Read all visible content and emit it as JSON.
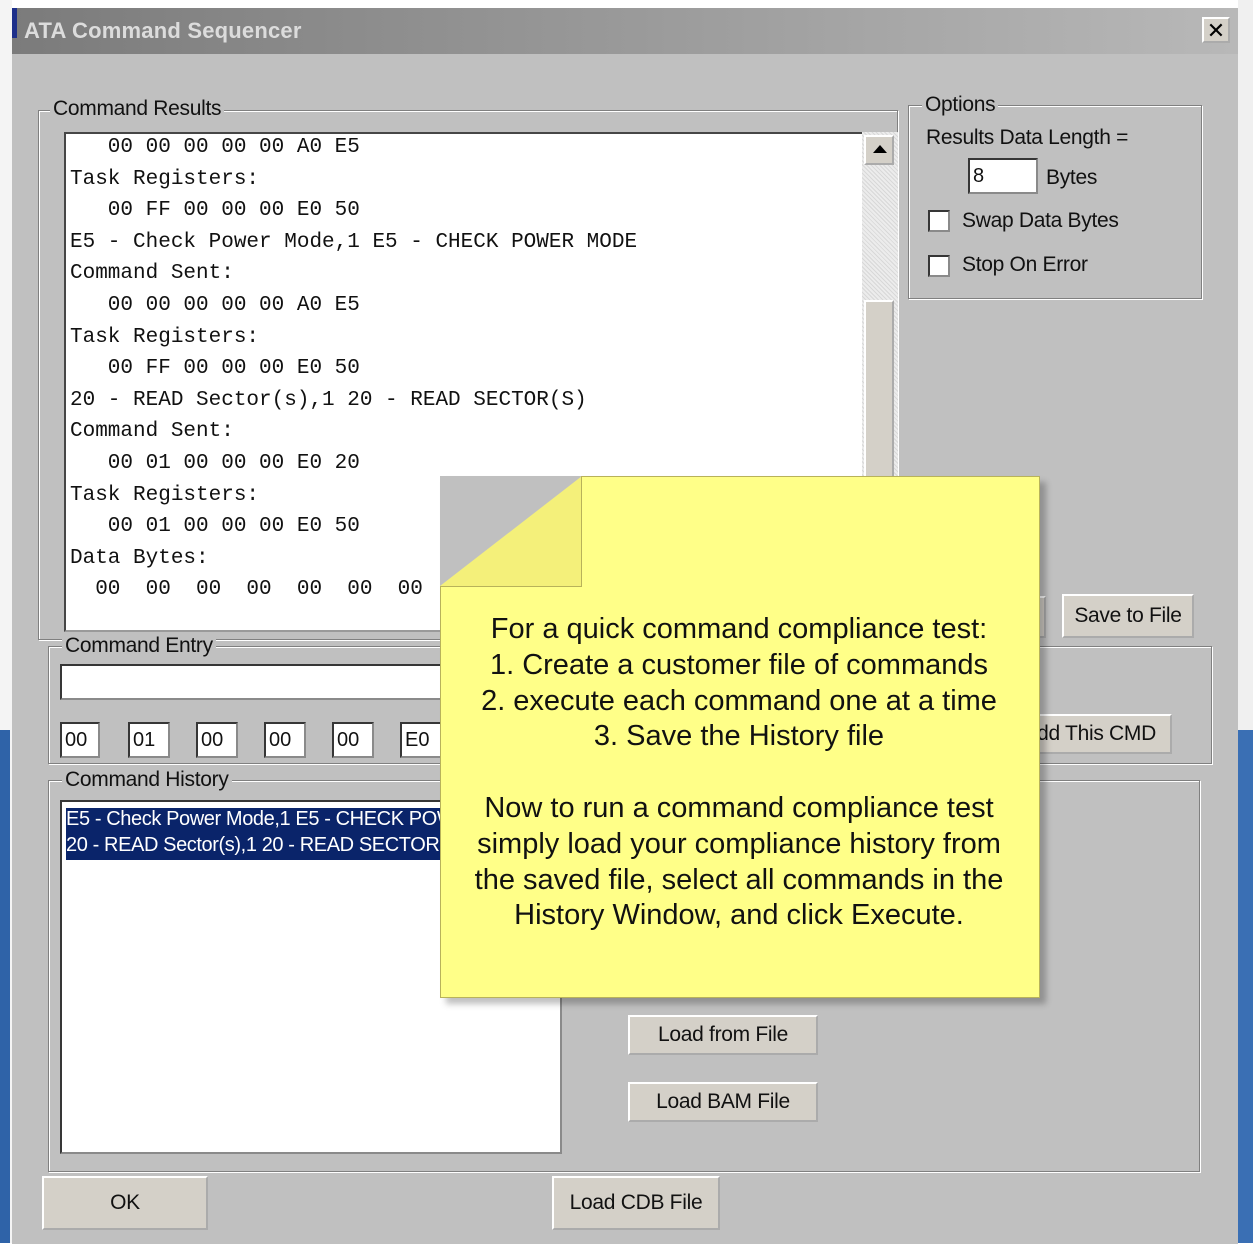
{
  "window": {
    "title": "ATA Command Sequencer",
    "close_glyph": "✕"
  },
  "results_group": {
    "label": "Command Results",
    "lines": [
      "   00 00 00 00 00 A0 E5",
      "Task Registers:",
      "   00 FF 00 00 00 E0 50",
      "E5 - Check Power Mode,1 E5 - CHECK POWER MODE",
      "Command Sent:",
      "   00 00 00 00 00 A0 E5",
      "Task Registers:",
      "   00 FF 00 00 00 E0 50",
      "20 - READ Sector(s),1 20 - READ SECTOR(S)",
      "Command Sent:",
      "   00 01 00 00 00 E0 20",
      "Task Registers:",
      "   00 01 00 00 00 E0 50",
      "Data Bytes:",
      "  00  00  00  00  00  00  00"
    ]
  },
  "options": {
    "label": "Options",
    "results_length_label": "Results Data Length =",
    "results_length_value": "8",
    "bytes_label": "Bytes",
    "swap_label": "Swap Data Bytes",
    "stop_label": "Stop On Error"
  },
  "buttons": {
    "save_to_file": "Save to File",
    "add_this_cmd": "dd This CMD",
    "load_from_file": "Load from File",
    "load_bam_file": "Load BAM File",
    "ok": "OK",
    "load_cdb_file": "Load CDB File"
  },
  "command_entry": {
    "label": "Command Entry",
    "text_value": "",
    "bytes": [
      "00",
      "01",
      "00",
      "00",
      "00",
      "E0"
    ]
  },
  "command_history": {
    "label": "Command History",
    "items": [
      "E5 - Check Power Mode,1 E5 - CHECK POWER MODE",
      "20 - READ Sector(s),1 20 - READ SECTOR(S)"
    ]
  },
  "note": {
    "lines": [
      "For a quick command compliance test:",
      "1. Create a customer file of commands",
      "2. execute each command one at a time",
      "3. Save the History file",
      "",
      "Now to run a command compliance test",
      "simply load your compliance history from",
      "the saved file, select all commands in the",
      "History Window, and click Execute."
    ]
  }
}
